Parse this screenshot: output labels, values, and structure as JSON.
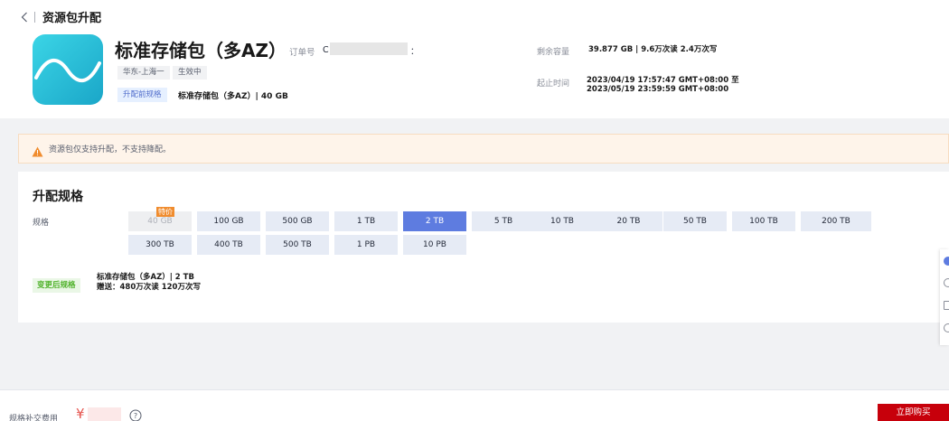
{
  "header": {
    "back_icon": "chevron-left-icon",
    "title": "资源包升配"
  },
  "product": {
    "name": "标准存储包（多AZ）",
    "order_label": "订单号",
    "order_prefix": "C",
    "order_suffix": "：",
    "region": "华东-上海一",
    "status": "生效中",
    "before_label": "升配前规格",
    "before_value": "标准存储包（多AZ）| 40 GB",
    "remaining_label": "剩余容量",
    "remaining_value": "39.877 GB | 9.6万次读 2.4万次写",
    "period_label": "起止时间",
    "period_start": "2023/04/19 17:57:47 GMT+08:00 至",
    "period_end": "2023/05/19 23:59:59 GMT+08:00"
  },
  "notice": {
    "icon": "warning-icon",
    "text": "资源包仅支持升配，不支持降配。"
  },
  "spec": {
    "title": "升配规格",
    "label": "规格",
    "special_tag": "特价",
    "options_row1": [
      "40 GB",
      "100 GB",
      "500 GB",
      "1 TB",
      "2 TB",
      "5 TB",
      "10 TB",
      "20 TB",
      "50 TB",
      "100 TB",
      "200 TB"
    ],
    "options_row2": [
      "300 TB",
      "400 TB",
      "500 TB",
      "1 PB",
      "10 PB"
    ],
    "selected": "2 TB",
    "disabled": "40 GB",
    "after_label": "变更后规格",
    "after_value": "标准存储包（多AZ）| 2 TB",
    "after_gift": "赠送：480万次读 120万次写"
  },
  "footer": {
    "fee_label": "规格补交费用",
    "currency": "¥",
    "help_icon": "help-circle-icon",
    "buy_label": "立即购买"
  },
  "colors": {
    "accent": "#5e7ce0",
    "buy": "#c7000b",
    "special": "#f08c2e",
    "notice_bg": "#fef4ea"
  }
}
